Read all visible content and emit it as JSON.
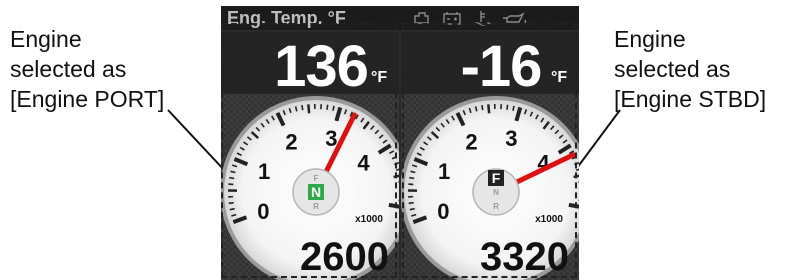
{
  "callouts": {
    "left": {
      "line1": "Engine",
      "line2": "selected as",
      "line3": "[Engine PORT]"
    },
    "right": {
      "line1": "Engine",
      "line2": "selected as",
      "line3": "[Engine STBD]"
    }
  },
  "screen": {
    "title": "Eng. Temp. °F",
    "status_icons": [
      "engine-icon",
      "battery-icon",
      "coolant-temp-icon",
      "oil-pressure-icon"
    ]
  },
  "gauges": [
    {
      "id": "port",
      "temperature": "136",
      "temp_unit": "°F",
      "rpm_scale_labels": [
        "0",
        "1",
        "2",
        "3",
        "4"
      ],
      "multiplier": "x1000",
      "rpm_value": "2600",
      "rpm_fraction": 0.65,
      "gear_labels": [
        "F",
        "N",
        "R"
      ],
      "selected_gear": "N",
      "gear_color": "#2fa84a"
    },
    {
      "id": "stbd",
      "temperature": "-16",
      "temp_unit": "°F",
      "rpm_scale_labels": [
        "0",
        "1",
        "2",
        "3",
        "4"
      ],
      "multiplier": "x1000",
      "rpm_value": "3320",
      "rpm_fraction": 0.83,
      "gear_labels": [
        "F",
        "N",
        "R"
      ],
      "selected_gear": "F",
      "gear_color": "#222222"
    }
  ],
  "colors": {
    "needle": "#e01010",
    "screen_bg": "#2a2a2a"
  }
}
